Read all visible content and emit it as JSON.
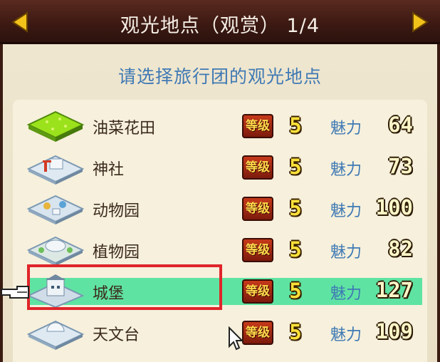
{
  "header": {
    "title": "观光地点（观赏） 1/4",
    "prev_label": "previous-page",
    "next_label": "next-page"
  },
  "subtitle": "请选择旅行团的观光地点",
  "labels": {
    "grade": "等级",
    "charm": "魅力"
  },
  "spots": [
    {
      "name": "油菜花田",
      "grade": "5",
      "charm": "64",
      "icon": "rape-flower-field-icon",
      "selected": false
    },
    {
      "name": "神社",
      "grade": "5",
      "charm": "73",
      "icon": "shrine-icon",
      "selected": false
    },
    {
      "name": "动物园",
      "grade": "5",
      "charm": "100",
      "icon": "zoo-icon",
      "selected": false
    },
    {
      "name": "植物园",
      "grade": "5",
      "charm": "82",
      "icon": "botanical-garden-icon",
      "selected": false
    },
    {
      "name": "城堡",
      "grade": "5",
      "charm": "127",
      "icon": "castle-icon",
      "selected": true
    },
    {
      "name": "天文台",
      "grade": "5",
      "charm": "109",
      "icon": "observatory-icon",
      "selected": false
    }
  ],
  "colors": {
    "header_bg": "#3d1a13",
    "panel_bg": "#efe6cf",
    "subtitle": "#3f79b4",
    "highlight": "#5fe3a2",
    "selection_box": "#e0242a",
    "grade_badge": "#c63a1a",
    "grade_value": "#ffe13a"
  }
}
